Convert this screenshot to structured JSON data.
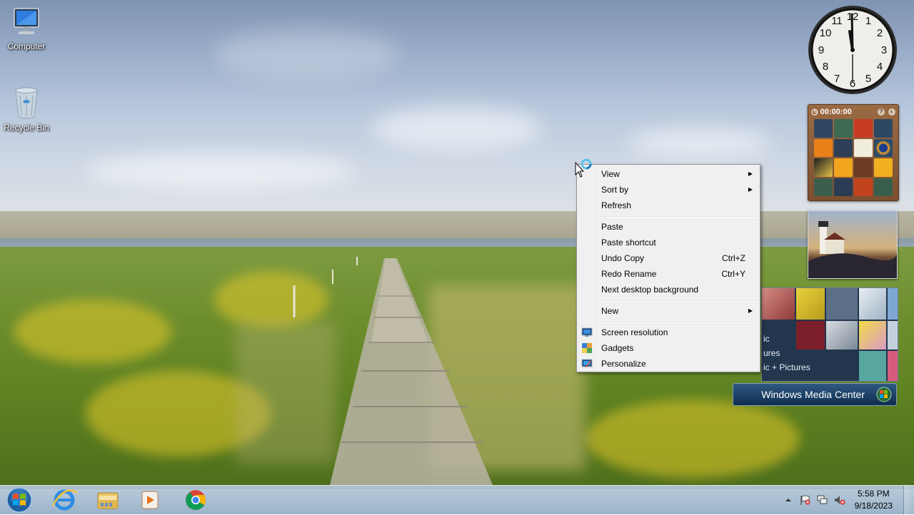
{
  "desktop": {
    "icons": [
      {
        "label": "Computer",
        "icon": "computer-icon"
      },
      {
        "label": "Recycle Bin",
        "icon": "recycle-bin-icon"
      }
    ]
  },
  "gadgets": {
    "clock": {
      "hour": 5,
      "minute": 59,
      "icon": "analog-clock-gadget"
    },
    "puzzle": {
      "timer": "00:00:00",
      "help_glyph": "?",
      "icon": "picture-puzzle-gadget"
    },
    "slideshow": {
      "icon": "slideshow-gadget"
    },
    "media_center": {
      "title": "Windows Media Center",
      "tile_texts": [
        "ic",
        "ures",
        "ic + Pictures"
      ]
    }
  },
  "context_menu": {
    "items": [
      {
        "label": "View",
        "submenu": true
      },
      {
        "label": "Sort by",
        "submenu": true
      },
      {
        "label": "Refresh"
      },
      {
        "label": "Paste"
      },
      {
        "label": "Paste shortcut"
      },
      {
        "label": "Undo Copy",
        "shortcut": "Ctrl+Z"
      },
      {
        "label": "Redo Rename",
        "shortcut": "Ctrl+Y"
      },
      {
        "label": "Next desktop background"
      },
      {
        "label": "New",
        "submenu": true
      },
      {
        "label": "Screen resolution",
        "icon": "screen-resolution-icon"
      },
      {
        "label": "Gadgets",
        "icon": "gadgets-icon"
      },
      {
        "label": "Personalize",
        "icon": "personalize-icon"
      }
    ]
  },
  "taskbar": {
    "start": "windows-start-orb",
    "pinned": [
      {
        "name": "Internet Explorer",
        "icon": "internet-explorer-icon"
      },
      {
        "name": "Windows Explorer",
        "icon": "file-explorer-icon"
      },
      {
        "name": "Windows Media Player",
        "icon": "media-player-icon"
      },
      {
        "name": "Google Chrome",
        "icon": "chrome-icon"
      }
    ],
    "tray": {
      "icons": [
        "show-hidden-icons-arrow",
        "action-center-flag-icon",
        "network-icon",
        "volume-muted-icon"
      ],
      "time": "5:58 PM",
      "date": "9/18/2023"
    }
  },
  "colors": {
    "menu_bg": "#f0f0f0",
    "taskbar": "#a6bdd2",
    "wmc_bar": "#1f4469"
  }
}
